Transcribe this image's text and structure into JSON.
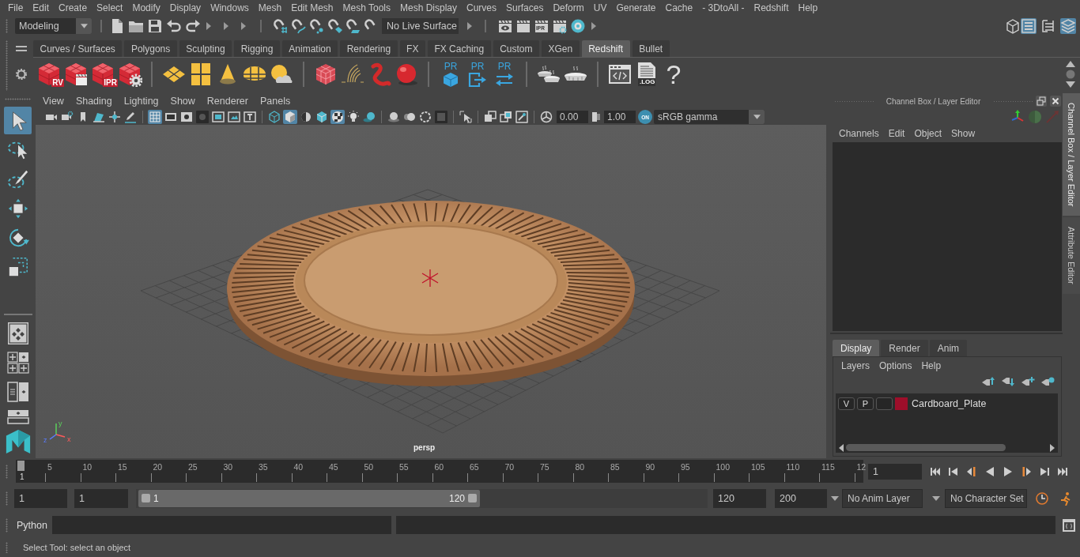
{
  "menu_bar": [
    "File",
    "Edit",
    "Create",
    "Select",
    "Modify",
    "Display",
    "Windows",
    "Mesh",
    "Edit Mesh",
    "Mesh Tools",
    "Mesh Display",
    "Curves",
    "Surfaces",
    "Deform",
    "UV",
    "Generate",
    "Cache",
    "- 3DtoAll -",
    "Redshift",
    "Help"
  ],
  "status_line": {
    "menu_set": "Modeling",
    "live_surface": "No Live Surface",
    "render_tools": [
      {
        "kind": "clapeye"
      },
      {
        "kind": "clap"
      },
      {
        "kind": "clap",
        "label": "IPR"
      },
      {
        "kind": "clapgear"
      },
      {
        "kind": "ring"
      }
    ],
    "panel_toggles": [
      {
        "kind": "wcube",
        "on": false
      },
      {
        "kind": "attr",
        "on": true
      },
      {
        "kind": "tools",
        "on": false
      },
      {
        "kind": "layers",
        "on": true
      }
    ]
  },
  "shelf": {
    "tabs": [
      {
        "label": "Curves / Surfaces",
        "selected": false
      },
      {
        "label": "Polygons",
        "selected": false
      },
      {
        "label": "Sculpting",
        "selected": false
      },
      {
        "label": "Rigging",
        "selected": false
      },
      {
        "label": "Animation",
        "selected": false
      },
      {
        "label": "Rendering",
        "selected": false
      },
      {
        "label": "FX",
        "selected": false
      },
      {
        "label": "FX Caching",
        "selected": false
      },
      {
        "label": "Custom",
        "selected": false
      },
      {
        "label": "XGen",
        "selected": false
      },
      {
        "label": "Redshift",
        "selected": true
      },
      {
        "label": "Bullet",
        "selected": false
      }
    ],
    "groups": [
      [
        {
          "kind": "rscube",
          "label": "RV"
        },
        {
          "kind": "rsclap"
        },
        {
          "kind": "rscube",
          "label": "IPR"
        },
        {
          "kind": "rsgear"
        }
      ],
      [
        {
          "kind": "plane"
        },
        {
          "kind": "quad"
        },
        {
          "kind": "cone"
        },
        {
          "kind": "dome"
        },
        {
          "kind": "sun"
        }
      ],
      [
        {
          "kind": "boxes"
        },
        {
          "kind": "hair"
        },
        {
          "kind": "worm"
        },
        {
          "kind": "ball"
        }
      ],
      [
        {
          "kind": "prbox",
          "label": "PR"
        },
        {
          "kind": "prout",
          "label": "PR"
        },
        {
          "kind": "prswap",
          "label": "PR"
        }
      ],
      [
        {
          "kind": "pies"
        },
        {
          "kind": "pie"
        }
      ],
      [
        {
          "kind": "code"
        },
        {
          "kind": "log",
          "label": ".LOG"
        },
        {
          "kind": "help",
          "label": "?"
        }
      ]
    ]
  },
  "toolbox": {
    "tools": [
      {
        "kind": "select",
        "selected": true
      },
      {
        "kind": "lasso",
        "selected": false
      },
      {
        "kind": "paint",
        "selected": false
      },
      {
        "kind": "move",
        "selected": false
      },
      {
        "kind": "rotate",
        "selected": false
      },
      {
        "kind": "scale",
        "selected": false
      }
    ]
  },
  "viewport": {
    "menu": [
      "View",
      "Shading",
      "Lighting",
      "Show",
      "Renderer",
      "Panels"
    ],
    "toolbar": [
      [
        {
          "kind": "camera",
          "on": false
        },
        {
          "kind": "camgear",
          "on": false
        },
        {
          "kind": "bookmark",
          "on": false
        },
        {
          "kind": "imgplane",
          "on": false
        },
        {
          "kind": "pan",
          "on": false
        },
        {
          "kind": "pencil",
          "on": false
        }
      ],
      [
        {
          "kind": "grid",
          "on": true
        },
        {
          "kind": "film",
          "on": false
        },
        {
          "kind": "resgate",
          "on": false
        },
        {
          "kind": "mask",
          "on": false
        },
        {
          "kind": "field",
          "on": false
        },
        {
          "kind": "safeaction",
          "on": false
        },
        {
          "kind": "safetitle",
          "on": false
        }
      ],
      [
        {
          "kind": "wirecube",
          "on": false
        },
        {
          "kind": "shadedcube",
          "on": true
        },
        {
          "kind": "halfshade",
          "on": false
        },
        {
          "kind": "texcube",
          "on": false
        },
        {
          "kind": "checker",
          "on": true
        },
        {
          "kind": "bulb",
          "on": false
        },
        {
          "kind": "shadow",
          "on": false
        }
      ],
      [
        {
          "kind": "ssao",
          "on": false
        },
        {
          "kind": "blur",
          "on": false
        },
        {
          "kind": "aa",
          "on": false
        },
        {
          "kind": "dof",
          "on": false
        }
      ],
      [
        {
          "kind": "isolate",
          "on": false
        }
      ],
      [
        {
          "kind": "xray",
          "on": false
        },
        {
          "kind": "xrayactive",
          "on": false
        },
        {
          "kind": "xrayjoint",
          "on": false
        }
      ]
    ],
    "exposure": "0.00",
    "gamma": "1.00",
    "color_management": "ON",
    "view_transform": "sRGB gamma",
    "camera": "persp",
    "axis_labels": [
      "y",
      "z",
      "x"
    ]
  },
  "channel_box": {
    "title": "Channel Box / Layer Editor",
    "menu": [
      "Channels",
      "Edit",
      "Object",
      "Show"
    ]
  },
  "layer_editor": {
    "tabs": [
      {
        "label": "Display",
        "selected": true
      },
      {
        "label": "Render",
        "selected": false
      },
      {
        "label": "Anim",
        "selected": false
      }
    ],
    "menu": [
      "Layers",
      "Options",
      "Help"
    ],
    "layers": [
      {
        "visibility": "V",
        "playback": "P",
        "name": "Cardboard_Plate",
        "color": "#9e0e2a"
      }
    ]
  },
  "side_tabs": [
    {
      "label": "Channel Box / Layer Editor",
      "selected": true
    },
    {
      "label": "Attribute Editor",
      "selected": false
    }
  ],
  "time_slider": {
    "level": 0,
    "playhead": "1",
    "labels": [
      "5",
      "10",
      "15",
      "20",
      "25",
      "30",
      "35",
      "40",
      "45",
      "50",
      "55",
      "60",
      "65",
      "70",
      "75",
      "80",
      "85",
      "90",
      "95",
      "100",
      "105",
      "110",
      "115",
      "12"
    ],
    "current_frame": "1"
  },
  "range_slider": {
    "start_time": "1",
    "range_start": "1",
    "level": 0.6,
    "handle_start": "1",
    "handle_end": "120",
    "range_end": "120",
    "end_time": "200",
    "anim_layer": "No Anim Layer",
    "character_set": "No Character Set"
  },
  "command_line": {
    "language": "Python"
  },
  "help_line": "Select Tool: select an object"
}
